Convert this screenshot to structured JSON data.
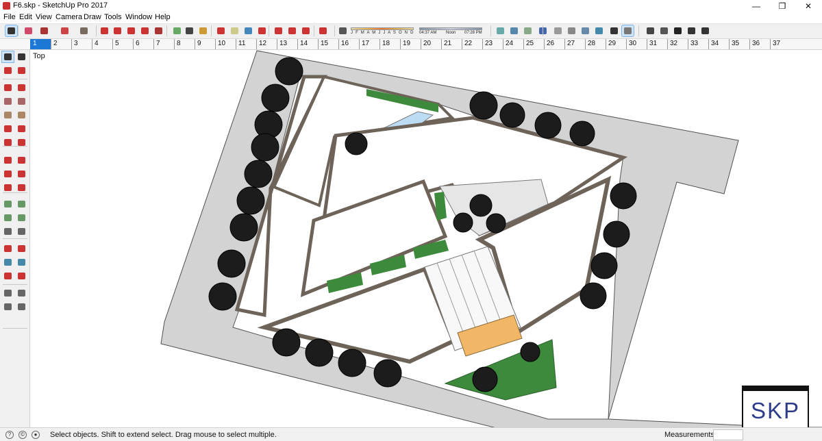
{
  "window": {
    "title": "F6.skp - SketchUp Pro 2017",
    "minimize_glyph": "—",
    "maximize_glyph": "❐",
    "close_glyph": "✕"
  },
  "menu": [
    "File",
    "Edit",
    "View",
    "Camera",
    "Draw",
    "Tools",
    "Window",
    "Help"
  ],
  "toolbar": {
    "shadow_months": "J F M A M J J A S O N D",
    "time_start": "04:37 AM",
    "time_mid": "Noon",
    "time_end": "07:28 PM",
    "icons": [
      "select-icon",
      "eraser-icon",
      "line-icon",
      "arc-icon",
      "rectangle-icon",
      "push-pull-icon",
      "move-icon",
      "rotate-icon",
      "scale-icon",
      "offset-icon",
      "tape-measure-icon",
      "text-icon",
      "paint-bucket-icon",
      "orbit-icon",
      "pan-icon",
      "zoom-icon",
      "zoom-extents-icon",
      "warehouse-icon",
      "extension-icon",
      "components-icon",
      "ruby-icon",
      "shadow-icon",
      "date-slider-icon",
      "time-slider-icon",
      "model-info-icon",
      "section-plane-icon",
      "section-cut-icon",
      "xray-icon",
      "wireframe-icon",
      "hidden-line-icon",
      "shaded-icon",
      "shaded-textures-icon",
      "monochrome-icon",
      "iso-view-icon",
      "top-view-icon",
      "front-view-icon",
      "right-view-icon",
      "back-view-icon",
      "left-view-icon"
    ]
  },
  "scene_tabs": [
    "1",
    "2",
    "3",
    "4",
    "5",
    "6",
    "7",
    "8",
    "9",
    "10",
    "11",
    "12",
    "13",
    "14",
    "15",
    "16",
    "17",
    "18",
    "19",
    "20",
    "21",
    "22",
    "23",
    "24",
    "25",
    "26",
    "27",
    "28",
    "29",
    "30",
    "31",
    "32",
    "33",
    "34",
    "35",
    "36",
    "37"
  ],
  "selected_scene": "1",
  "view_label": "Top",
  "status": {
    "text": "Select objects. Shift to extend select. Drag mouse to select multiple.",
    "measurements_label": "Measurements",
    "measurements_value": ""
  },
  "logo": "SKP",
  "colors": {
    "accent": "#1c78d4",
    "road": "#d3d3d3",
    "wall": "#6e6359",
    "grass": "#3d8a3c",
    "pool": "#bcdcf3",
    "stairs": "#f2b766"
  }
}
